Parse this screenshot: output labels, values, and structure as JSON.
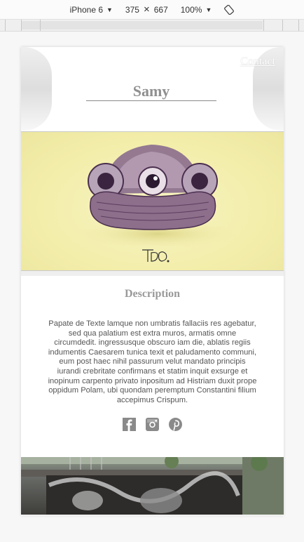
{
  "devtools": {
    "device": "iPhone 6",
    "width": "375",
    "height": "667",
    "zoom": "100%"
  },
  "header": {
    "contact_link": "Contact",
    "title": "Samy"
  },
  "hero": {
    "signature": "TBO."
  },
  "description": {
    "heading": "Description",
    "body": "Papate de Texte lamque non umbratis fallaciis res agebatur, sed qua palatium est extra muros, armatis omne circumdedit. ingressusque obscuro iam die, ablatis regiis indumentis Caesarem tunica texit et paludamento communi, eum post haec nihil passurum velut mandato principis iurandi crebritate confirmans et statim inquit exsurge et inopinum carpento privato inpositum ad Histriam duxit prope oppidum Polam, ubi quondam peremptum Constantini filium accepimus Crispum."
  },
  "social": [
    "facebook-icon",
    "instagram-icon",
    "pinterest-icon"
  ],
  "colors": {
    "hero_bg": "#f3eeaa",
    "title_gray": "#8f8f8f",
    "icon_gray": "#888888"
  }
}
